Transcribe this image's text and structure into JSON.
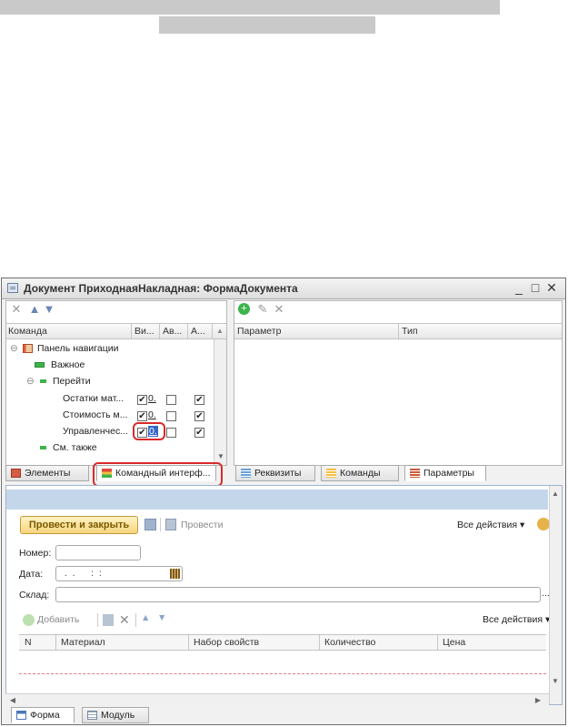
{
  "window": {
    "title": "Документ ПриходнаяНакладная: ФормаДокумента",
    "min": "_",
    "max": "□",
    "close": "✕"
  },
  "left_pane": {
    "columns": [
      "Команда",
      "Ви...",
      "Ав...",
      "А..."
    ],
    "tree": [
      {
        "label": "Панель навигации"
      },
      {
        "label": "Важное"
      },
      {
        "label": "Перейти"
      },
      {
        "label": "Остатки мат...",
        "o": "0."
      },
      {
        "label": "Стоимость м...",
        "o": "0."
      },
      {
        "label": "Управленчес...",
        "o": "0."
      },
      {
        "label": "См. также"
      }
    ],
    "tabs": [
      "Элементы",
      "Командный интерф..."
    ]
  },
  "right_pane": {
    "columns": [
      "Параметр",
      "Тип"
    ],
    "tabs": [
      "Реквизиты",
      "Команды",
      "Параметры"
    ]
  },
  "form": {
    "post_close_button": "Провести и закрыть",
    "post_button": "Провести",
    "all_actions": "Все действия ▾",
    "number_label": "Номер:",
    "date_label": "Дата:",
    "date_value": " .  .      :  :",
    "warehouse_label": "Склад:",
    "ellipsis": "...",
    "add_button": "Добавить",
    "all_actions2": "Все действия ▾",
    "table_columns": [
      "N",
      "Материал",
      "Набор свойств",
      "Количество",
      "Цена"
    ]
  },
  "bottom_tabs": [
    "Форма",
    "Модуль"
  ],
  "colors": {
    "accent_red": "#d92a2a",
    "header_blue": "#c4d6ea"
  }
}
